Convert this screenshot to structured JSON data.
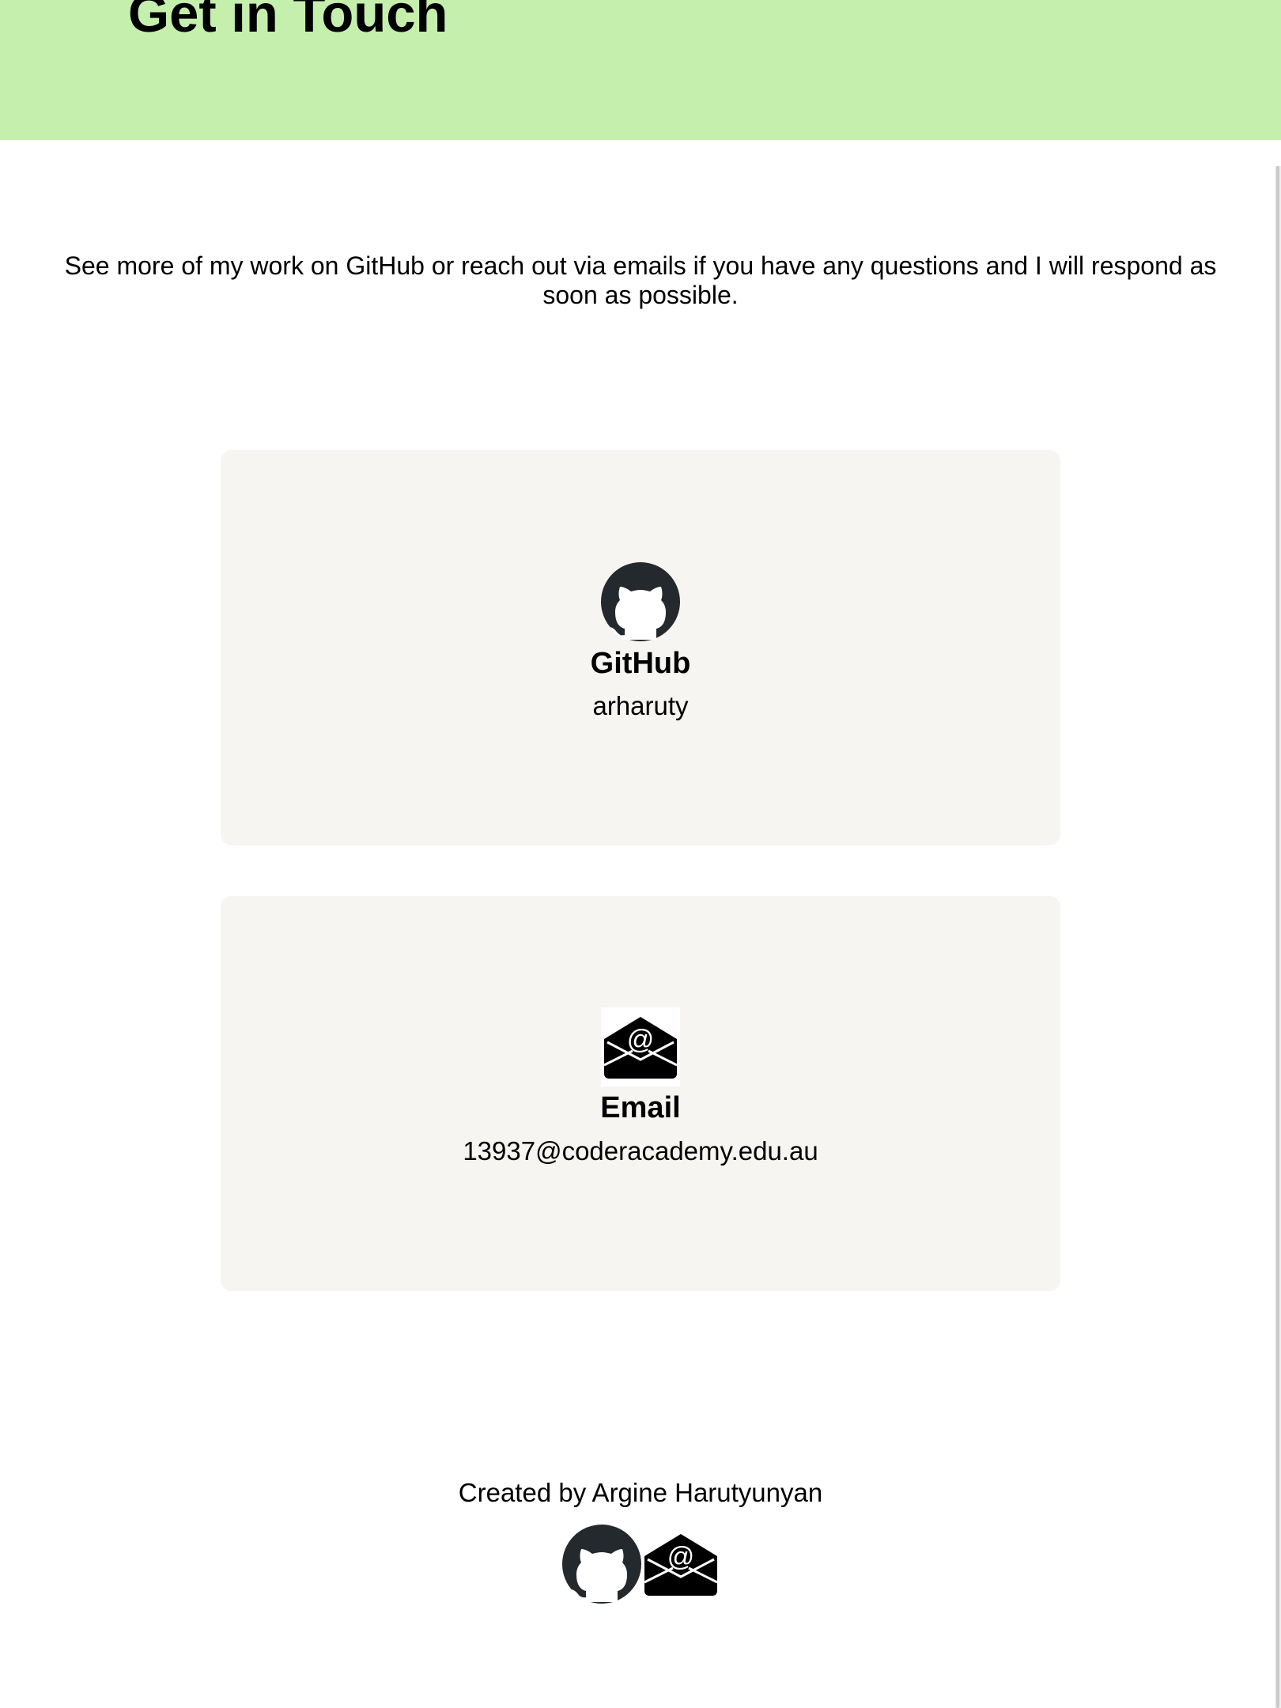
{
  "header": {
    "title": "Get in Touch",
    "background_color": "#c5efad"
  },
  "intro": {
    "text": "See more of my work on GitHub or reach out via emails if you have any questions and I will respond as soon as possible."
  },
  "cards": [
    {
      "icon": "github-icon",
      "title": "GitHub",
      "value": "arharuty"
    },
    {
      "icon": "email-envelope-icon",
      "title": "Email",
      "value": "13937@coderacademy.edu.au"
    }
  ],
  "footer": {
    "text": "Created by Argine Harutyunyan",
    "icons": [
      "github-icon",
      "email-envelope-icon"
    ]
  },
  "colors": {
    "card_background": "#f6f5f2",
    "icon_dark": "#24292e",
    "icon_black": "#000000"
  }
}
